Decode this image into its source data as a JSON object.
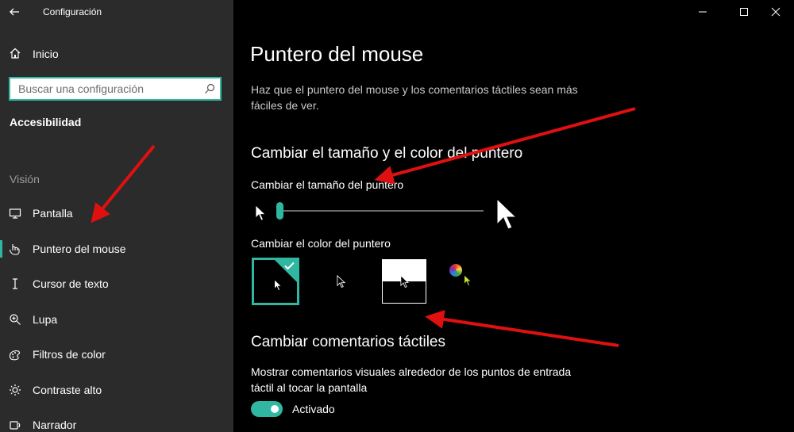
{
  "window": {
    "title": "Configuración",
    "back_icon": "back-arrow-icon",
    "controls": [
      "minimize-icon",
      "maximize-icon",
      "close-icon"
    ]
  },
  "sidebar": {
    "home_label": "Inicio",
    "home_icon": "home-icon",
    "search_placeholder": "Buscar una configuración",
    "search_icon": "search-icon",
    "section_title": "Accesibilidad",
    "group_label": "Visión",
    "items": [
      {
        "label": "Pantalla",
        "icon": "monitor-icon",
        "selected": false
      },
      {
        "label": "Puntero del mouse",
        "icon": "pointer-hand-icon",
        "selected": true
      },
      {
        "label": "Cursor de texto",
        "icon": "text-cursor-icon",
        "selected": false
      },
      {
        "label": "Lupa",
        "icon": "magnifier-icon",
        "selected": false
      },
      {
        "label": "Filtros de color",
        "icon": "color-filter-icon",
        "selected": false
      },
      {
        "label": "Contraste alto",
        "icon": "brightness-icon",
        "selected": false
      },
      {
        "label": "Narrador",
        "icon": "narrator-icon",
        "selected": false
      }
    ]
  },
  "main": {
    "title": "Puntero del mouse",
    "description": "Haz que el puntero del mouse y los comentarios táctiles sean más fáciles de ver.",
    "size_color_section": {
      "heading": "Cambiar el tamaño y el color del puntero",
      "size_label": "Cambiar el tamaño del puntero",
      "size_value": 1,
      "color_label": "Cambiar el color del puntero",
      "color_options": [
        {
          "name": "white-pointer-option",
          "selected": true
        },
        {
          "name": "black-pointer-option",
          "selected": false
        },
        {
          "name": "inverted-pointer-option",
          "selected": false
        },
        {
          "name": "custom-pointer-option",
          "selected": false
        }
      ]
    },
    "touch_section": {
      "heading": "Cambiar comentarios táctiles",
      "description": "Mostrar comentarios visuales alrededor de los puntos de entrada táctil al tocar la pantalla",
      "toggle_label": "Activado",
      "toggle_on": true
    }
  },
  "colors": {
    "accent": "#2fb7a2",
    "sidebar_bg": "#2b2b2b",
    "main_bg": "#000000",
    "annotation_arrows": "#e01010"
  }
}
